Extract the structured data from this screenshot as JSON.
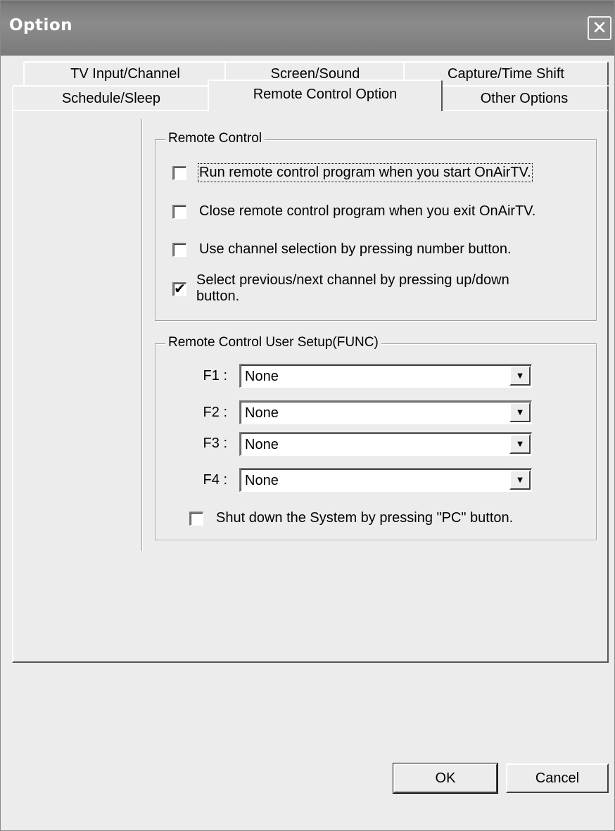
{
  "window": {
    "title": "Option"
  },
  "tabs": {
    "row1": [
      "TV Input/Channel",
      "Screen/Sound",
      "Capture/Time Shift"
    ],
    "row2": [
      "Schedule/Sleep",
      "Remote Control Option",
      "Other Options"
    ],
    "active": "Remote Control Option"
  },
  "remote_control": {
    "legend": "Remote Control",
    "options": [
      {
        "label": "Run remote control program when you start OnAirTV.",
        "checked": false
      },
      {
        "label": "Close remote control program when you exit OnAirTV.",
        "checked": false
      },
      {
        "label": "Use channel selection by pressing number button.",
        "checked": false
      },
      {
        "label_line1": "Select previous/next channel by pressing up/down",
        "label_line2": "button.",
        "checked": true
      }
    ]
  },
  "user_setup": {
    "legend": "Remote Control User Setup(FUNC)",
    "functions": [
      {
        "label": "F1 :",
        "value": "None"
      },
      {
        "label": "F2 :",
        "value": "None"
      },
      {
        "label": "F3 :",
        "value": "None"
      },
      {
        "label": "F4 :",
        "value": "None"
      }
    ],
    "shutdown": {
      "label": "Shut down the System by pressing \"PC\" button.",
      "checked": false
    }
  },
  "buttons": {
    "ok": "OK",
    "cancel": "Cancel"
  }
}
